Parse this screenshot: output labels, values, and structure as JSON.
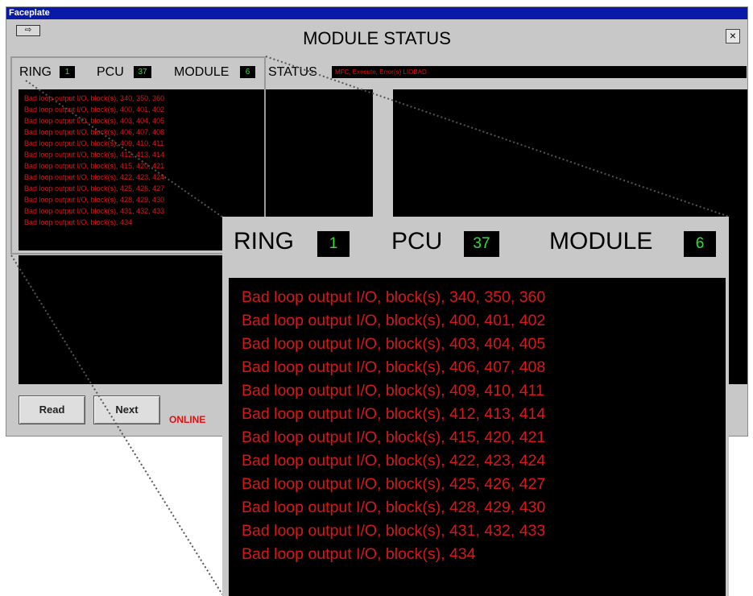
{
  "window": {
    "title": "Faceplate",
    "heading": "MODULE STATUS",
    "close_label": "×",
    "menu_icon": "⇨"
  },
  "header": {
    "ring_label": "RING",
    "ring_value": "1",
    "pcu_label": "PCU",
    "pcu_value": "37",
    "module_label": "MODULE",
    "module_value": "6",
    "status_label": "STATUS",
    "status_value": "MFC, Execute, Error(s) LIOBAD"
  },
  "messages": [
    "Bad loop output I/O, block(s), 340, 350, 360",
    "Bad loop output I/O, block(s), 400, 401, 402",
    "Bad loop output I/O, block(s), 403, 404, 405",
    "Bad loop output I/O, block(s), 406, 407, 408",
    "Bad loop output I/O, block(s), 409, 410, 411",
    "Bad loop output I/O, block(s), 412, 413, 414",
    "Bad loop output I/O, block(s), 415, 420, 421",
    "Bad loop output I/O, block(s), 422, 423, 424",
    "Bad loop output I/O, block(s), 425, 426, 427",
    "Bad loop output I/O, block(s), 428, 429, 430",
    "Bad loop output I/O, block(s), 431, 432, 433",
    "Bad loop output I/O, block(s), 434"
  ],
  "buttons": {
    "read": "Read",
    "next": "Next"
  },
  "connection_status": "ONLINE",
  "colors": {
    "title_bar": "#0a1aa8",
    "error_text": "#d81818",
    "value_text": "#30e030",
    "panel_bg": "#000000",
    "window_bg": "#c8c8c8"
  }
}
